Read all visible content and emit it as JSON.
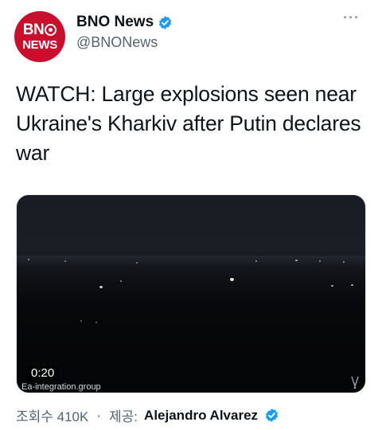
{
  "account": {
    "avatar_line1": "BN",
    "avatar_line2": "NEWS",
    "display_name": "BNO News",
    "handle": "@BNONews",
    "verified": true
  },
  "tweet": {
    "text": "WATCH: Large explosions seen near Ukraine's Kharkiv after Putin declares war"
  },
  "video": {
    "duration": "0:20",
    "watermark": "Ea-integration.group"
  },
  "footer": {
    "views_label": "조회수 410K",
    "separator": "·",
    "credit_label": "제공:",
    "credit_name": "Alejandro Alvarez"
  },
  "colors": {
    "brand_red": "#c8102e",
    "verified_blue": "#1d9bf0",
    "secondary_text": "#536471"
  }
}
